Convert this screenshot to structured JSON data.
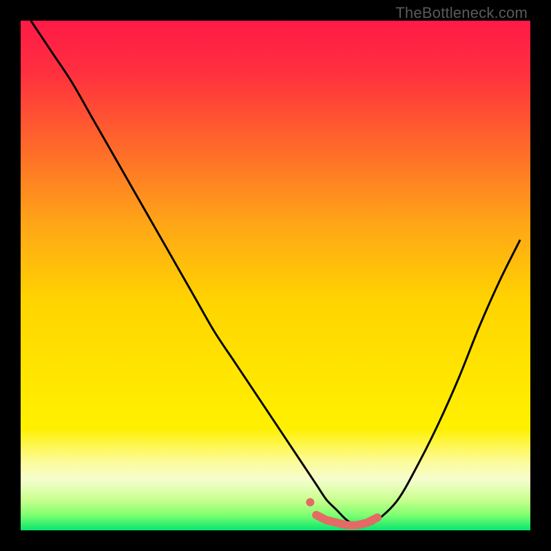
{
  "watermark": "TheBottleneck.com",
  "colors": {
    "frame": "#000000",
    "curve": "#000000",
    "marker": "#e46a66",
    "gradient_stops": [
      {
        "offset": 0.0,
        "color": "#ff1a46"
      },
      {
        "offset": 0.1,
        "color": "#ff2f3f"
      },
      {
        "offset": 0.25,
        "color": "#ff6a2a"
      },
      {
        "offset": 0.4,
        "color": "#ffa617"
      },
      {
        "offset": 0.55,
        "color": "#ffd400"
      },
      {
        "offset": 0.7,
        "color": "#ffe600"
      },
      {
        "offset": 0.8,
        "color": "#fff000"
      },
      {
        "offset": 0.86,
        "color": "#fdfb8f"
      },
      {
        "offset": 0.9,
        "color": "#f6fdcf"
      },
      {
        "offset": 0.94,
        "color": "#c9ff8f"
      },
      {
        "offset": 0.97,
        "color": "#7fff70"
      },
      {
        "offset": 1.0,
        "color": "#06e66e"
      }
    ]
  },
  "chart_data": {
    "type": "line",
    "title": "",
    "xlabel": "",
    "ylabel": "",
    "xlim": [
      0,
      100
    ],
    "ylim": [
      0,
      100
    ],
    "series": [
      {
        "name": "bottleneck-curve",
        "x": [
          2,
          6,
          10,
          14,
          18,
          22,
          26,
          30,
          34,
          38,
          42,
          46,
          50,
          54,
          58,
          60,
          62,
          64,
          66,
          68,
          70,
          74,
          78,
          82,
          86,
          90,
          94,
          98
        ],
        "y": [
          100,
          94,
          88,
          81,
          74,
          67,
          60,
          53,
          46,
          39,
          33,
          27,
          21,
          15,
          9,
          6,
          4,
          2,
          1,
          1,
          2,
          6,
          13,
          21,
          30,
          40,
          49,
          57
        ]
      }
    ],
    "markers": {
      "name": "optimal-range",
      "x": [
        58,
        60,
        62,
        64,
        66,
        68,
        70
      ],
      "y": [
        3,
        2,
        1.5,
        1,
        1,
        1.5,
        2.5
      ],
      "r": [
        6,
        5,
        5,
        5,
        5,
        6,
        7
      ]
    }
  }
}
